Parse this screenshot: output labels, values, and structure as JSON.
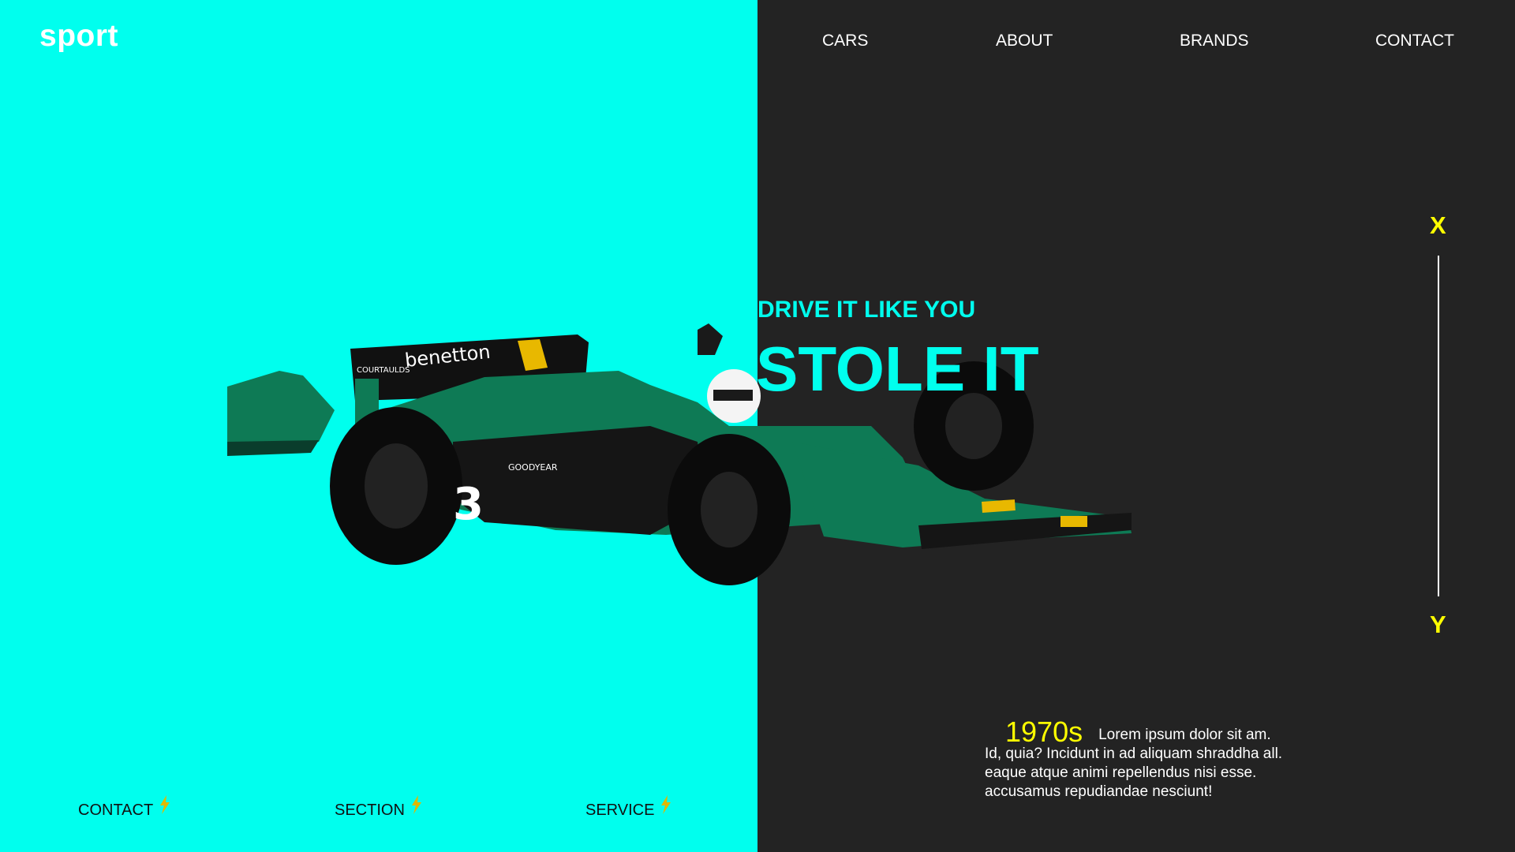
{
  "brand": {
    "logo": "sport"
  },
  "nav": {
    "items": [
      "CARS",
      "ABOUT",
      "BRANDS",
      "CONTACT"
    ]
  },
  "hero": {
    "tagline": "DRIVE IT LIKE YOU",
    "headline": "STOLE IT"
  },
  "axis": {
    "top": "X",
    "bottom": "Y"
  },
  "era": {
    "year": "1970s",
    "line1": "Lorem ipsum dolor sit am.",
    "line2": "Id, quia? Incidunt in ad aliquam shraddha all.",
    "line3": "eaque atque animi repellendus nisi esse.",
    "line4": "accusamus repudiandae nesciunt!"
  },
  "footer": {
    "links": [
      "CONTACT",
      "SECTION",
      "SERVICE"
    ]
  },
  "car": {
    "number": "3",
    "sponsor": "benetton",
    "sponsor2": "COURTAULDS",
    "tyre_brand": "GOODYEAR"
  },
  "colors": {
    "accent_cyan": "#00ffee",
    "dark_bg": "#232323",
    "highlight_yellow": "#ffff00",
    "car_green": "#0e7a55"
  },
  "icons": [
    "bolt-icon"
  ]
}
